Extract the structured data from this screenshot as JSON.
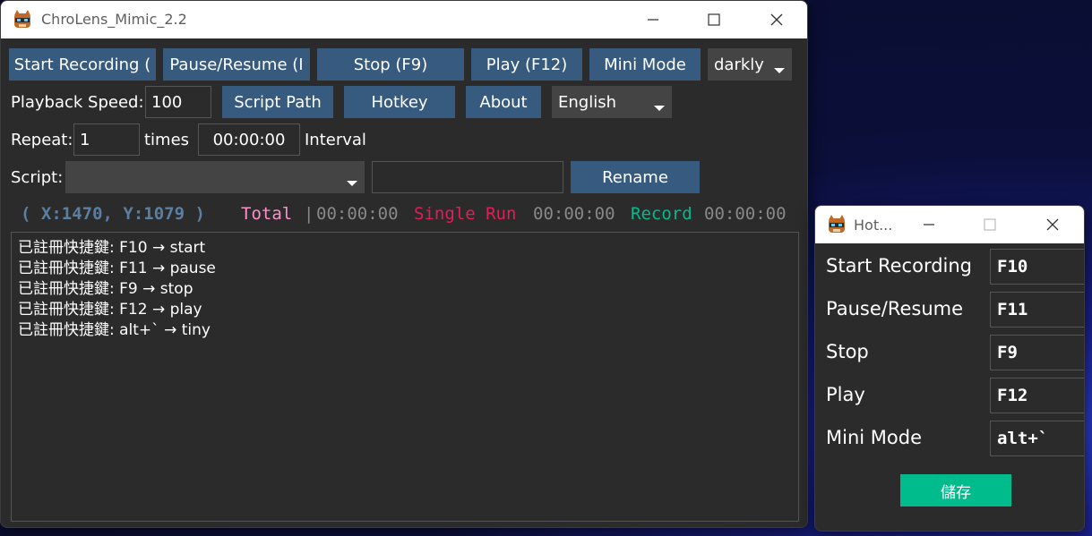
{
  "main_window": {
    "title": "ChroLens_Mimic_2.2",
    "toolbar": {
      "start_recording": "Start Recording (",
      "pause_resume": "Pause/Resume (I",
      "stop": "Stop (F9)",
      "play": "Play (F12)",
      "mini_mode": "Mini Mode",
      "theme": "darkly"
    },
    "row2": {
      "playback_speed_label": "Playback Speed:",
      "playback_speed_value": "100",
      "script_path": "Script Path",
      "hotkey": "Hotkey",
      "about": "About",
      "language": "English"
    },
    "row3": {
      "repeat_label": "Repeat:",
      "repeat_value": "1",
      "times_label": "times",
      "interval_value": "00:00:00",
      "interval_label": "Interval"
    },
    "row4": {
      "script_label": "Script:",
      "script_value": "",
      "rename_value": "",
      "rename": "Rename"
    },
    "status": {
      "coords": "( X:1470, Y:1079 )",
      "total_label": "Total",
      "total_time": "00:00:00",
      "single_run_label": "Single Run",
      "single_run_time": "00:00:00",
      "record_label": "Record",
      "record_time": "00:00:00",
      "colors": {
        "coords": "#5a7fa3",
        "total": "#ff8fc8",
        "single_run": "#e01e5a",
        "record": "#00bc8c",
        "time": "#888888"
      }
    },
    "log_lines": [
      "已註冊快捷鍵: F10 → start",
      "已註冊快捷鍵: F11 → pause",
      "已註冊快捷鍵: F9 → stop",
      "已註冊快捷鍵: F12 → play",
      "已註冊快捷鍵: alt+` → tiny"
    ]
  },
  "hotkey_window": {
    "title": "Hot...",
    "rows": [
      {
        "label": "Start Recording",
        "value": "F10"
      },
      {
        "label": "Pause/Resume",
        "value": "F11"
      },
      {
        "label": "Stop",
        "value": "F9"
      },
      {
        "label": "Play",
        "value": "F12"
      },
      {
        "label": "Mini Mode",
        "value": "alt+`"
      }
    ],
    "save": "儲存"
  },
  "colors": {
    "button": "#375a7f",
    "save_button": "#00bc8c",
    "window_bg": "#2b2b2b"
  }
}
